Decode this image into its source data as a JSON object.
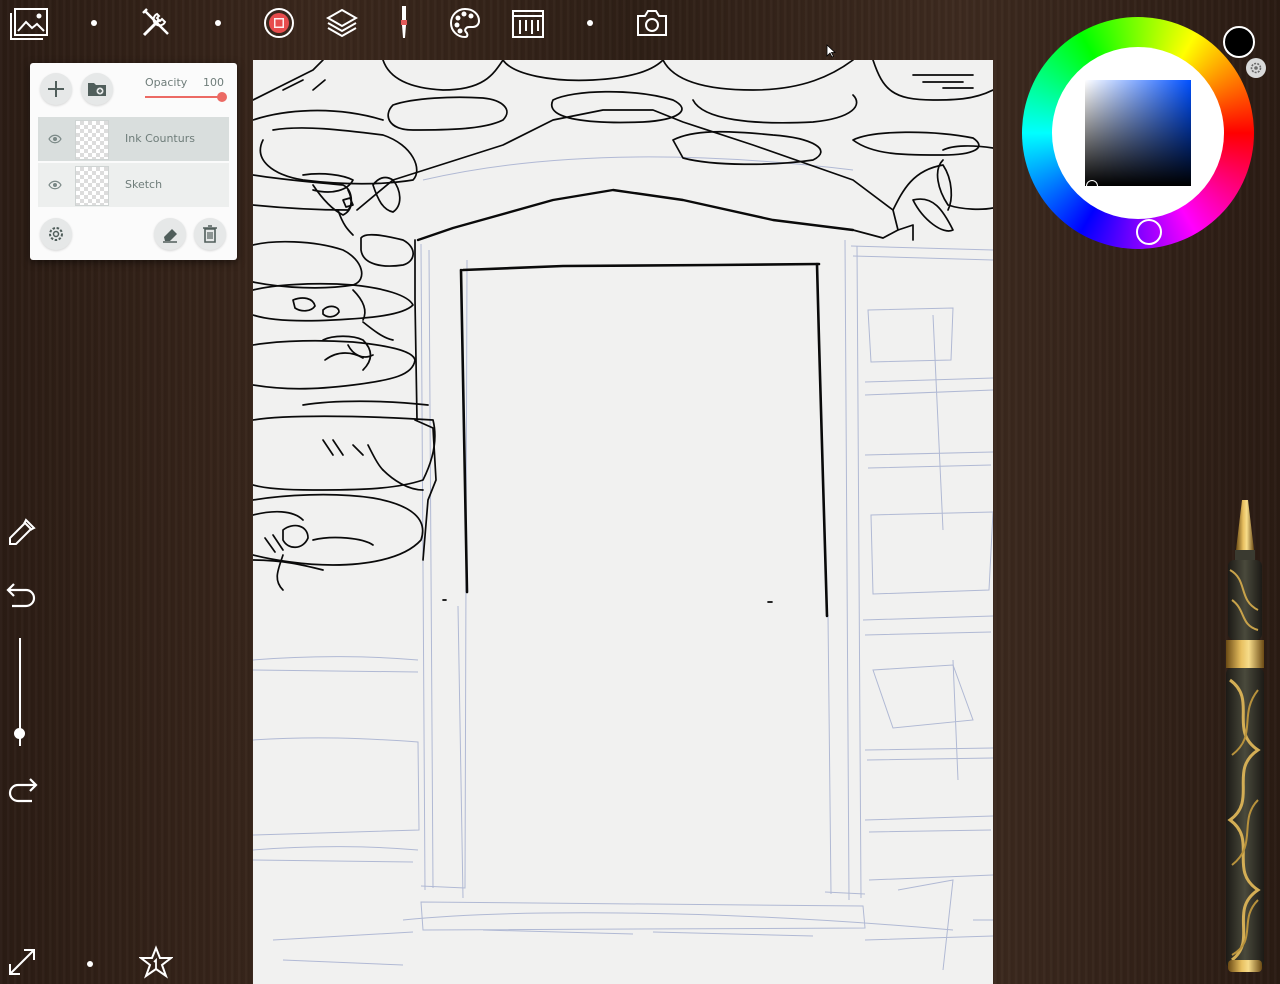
{
  "toolbar": {
    "icons": [
      "gallery-icon",
      "tools-icon",
      "record-icon",
      "layers-icon",
      "brush-icon",
      "palette-icon",
      "guides-icon",
      "camera-icon"
    ]
  },
  "layers_panel": {
    "opacity_label": "Opacity",
    "opacity_value": "100",
    "opacity_level": 1.0,
    "accent_color": "#ec6a64",
    "layers": [
      {
        "name": "Ink Counturs",
        "selected": true,
        "visible": true
      },
      {
        "name": "Sketch",
        "selected": false,
        "visible": true
      }
    ]
  },
  "color_picker": {
    "current_color": "#000000",
    "square_hue": "#0050ff"
  },
  "left_toolbar": {
    "icons": [
      "eyedropper-icon",
      "undo-icon",
      "brush-size-slider",
      "redo-icon"
    ]
  },
  "bottom_toolbar": {
    "icons": [
      "fullscreen-icon",
      "favorites-icon"
    ]
  }
}
